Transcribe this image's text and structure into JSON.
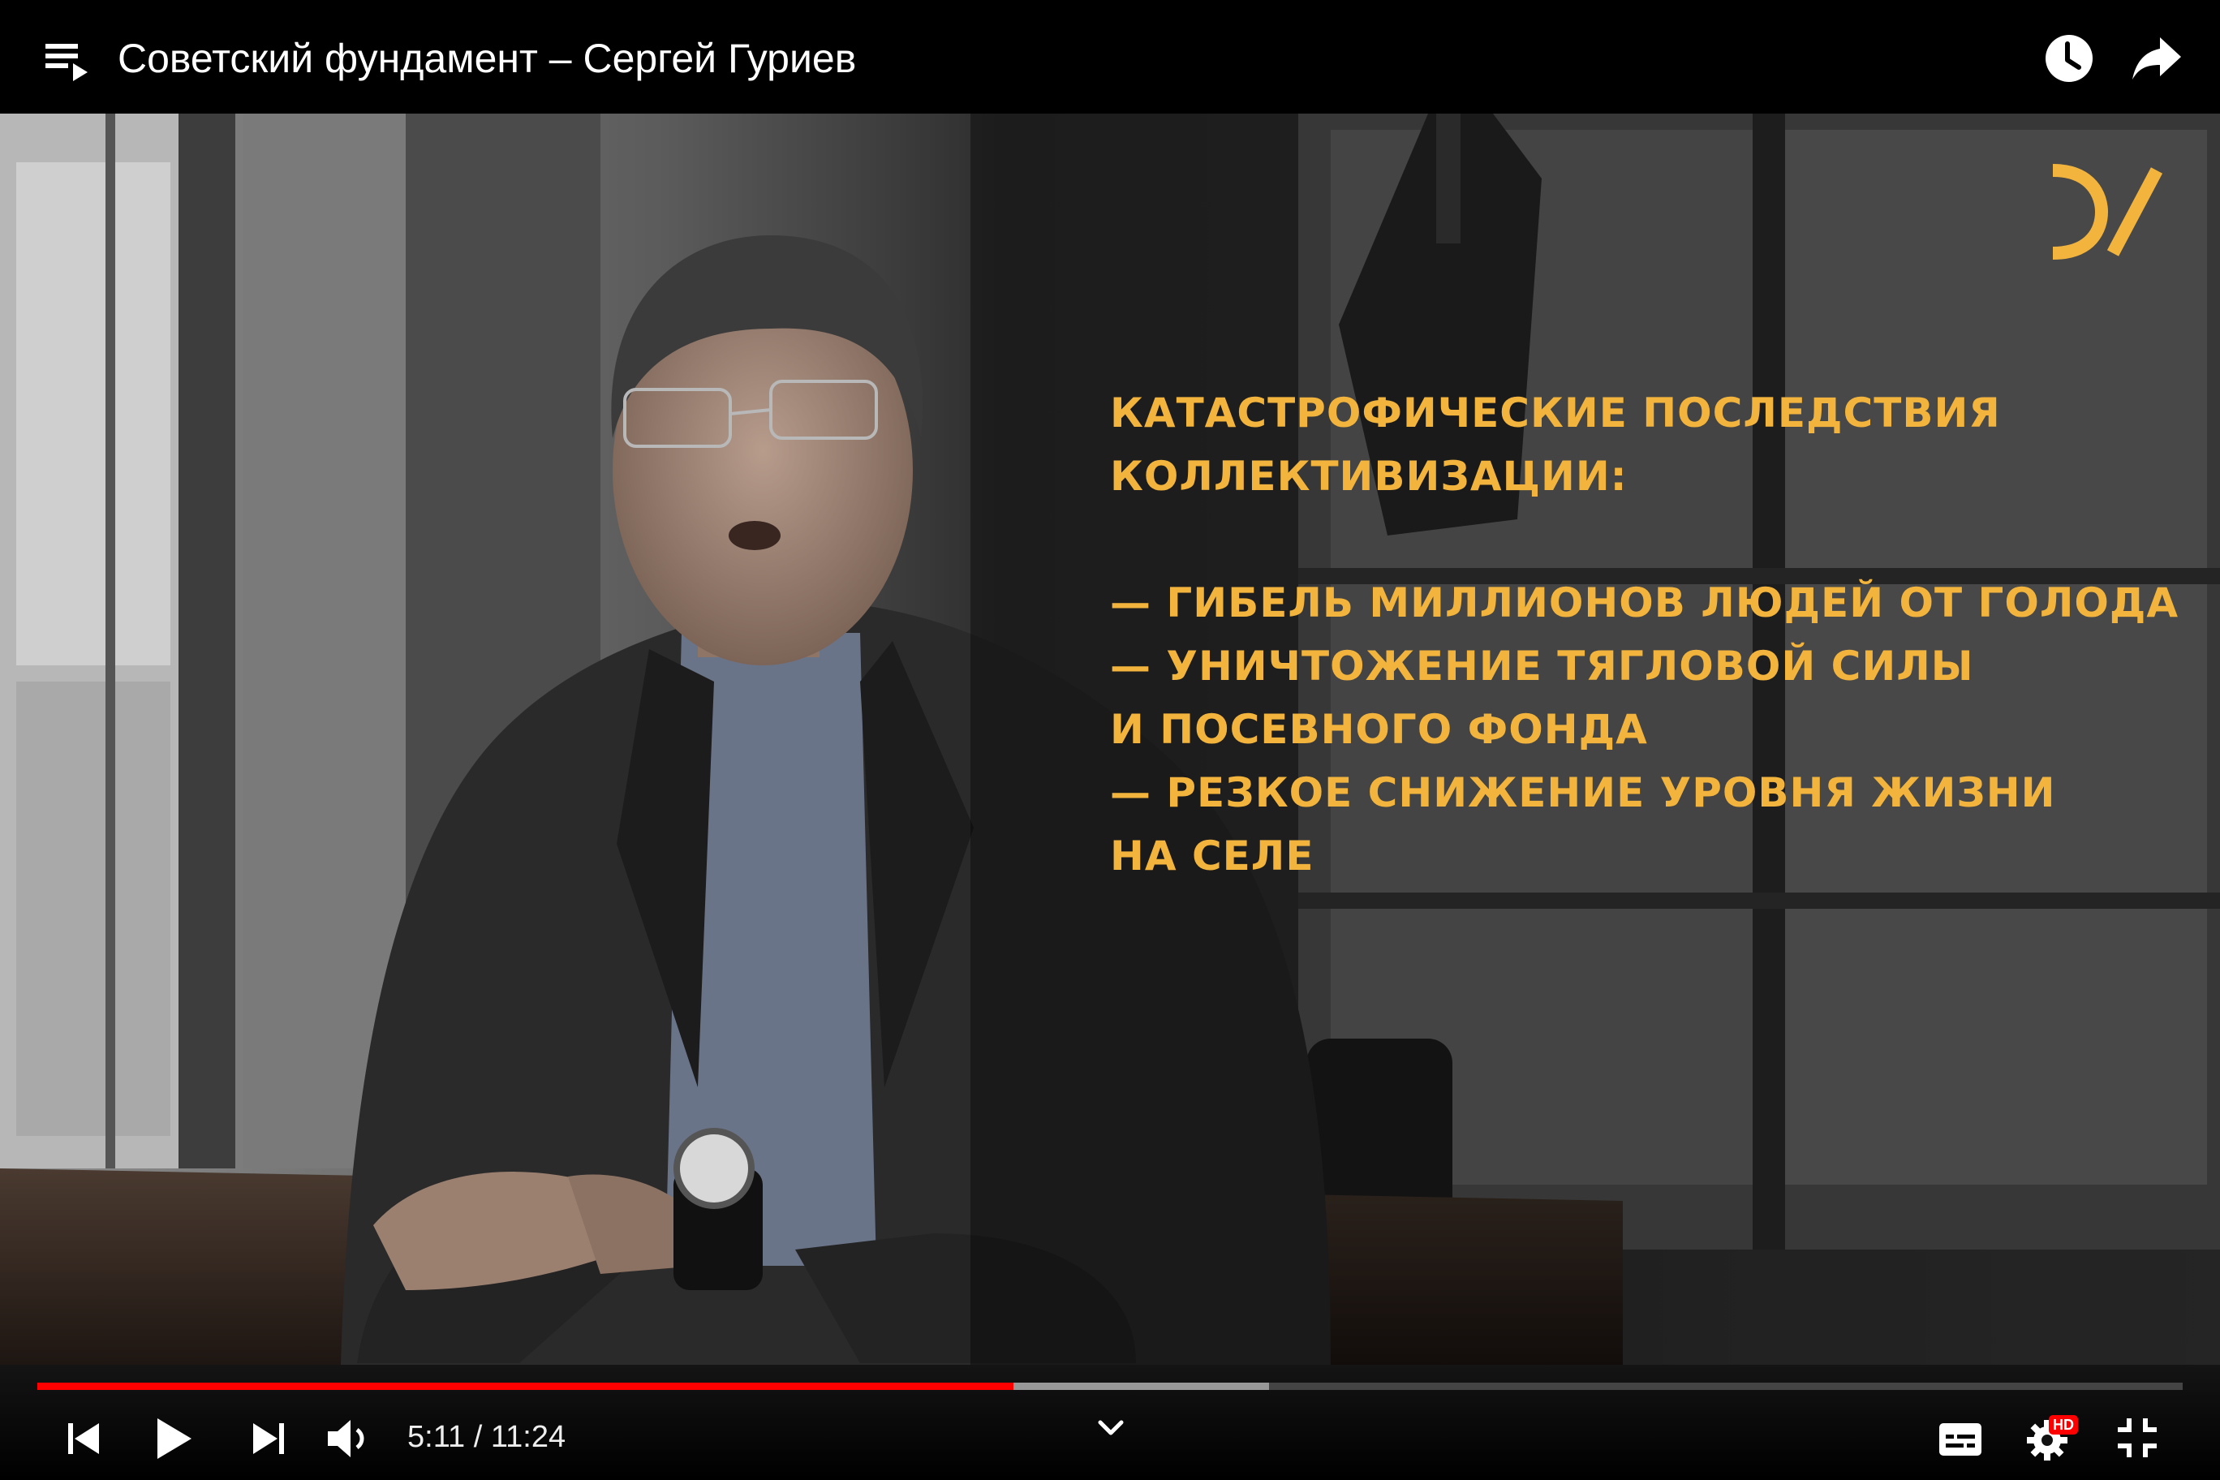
{
  "player": {
    "title": "Советский фундамент – Сергей Гуриев",
    "current_time": "5:11",
    "separator": "/",
    "duration": "11:24",
    "progress_played_fraction": 0.455,
    "progress_buffered_fraction": 0.574,
    "quality_badge": "HD",
    "accent_color": "#ff0000"
  },
  "slide": {
    "text_color": "#f2b43c",
    "heading": [
      "Катастрофические последствия",
      "коллективизации:"
    ],
    "items": [
      "— гибель миллионов людей от голода",
      "— уничтожение тягловой силы",
      "и посевного фонда",
      "— резкое снижение уровня жизни",
      "на селе"
    ]
  },
  "icons": {
    "playlist": "playlist-icon",
    "watch_later": "clock-icon",
    "share": "share-arrow-icon",
    "previous": "skip-previous-icon",
    "play": "play-icon",
    "next": "skip-next-icon",
    "volume": "volume-icon",
    "expand": "chevron-down-icon",
    "subtitles": "subtitles-icon",
    "settings": "gear-icon",
    "exit_fullscreen": "exit-fullscreen-icon",
    "channel_logo": "channel-logo"
  }
}
